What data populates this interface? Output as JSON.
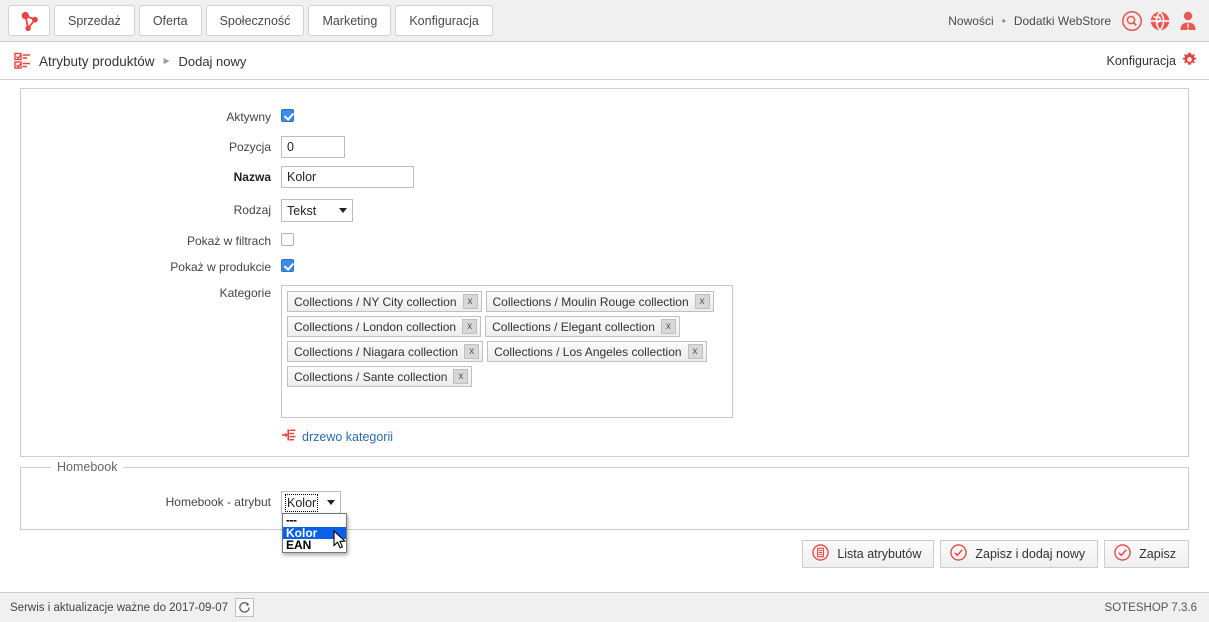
{
  "topbar": {
    "logo_icon": "soteshop-logo-icon",
    "nav": [
      {
        "label": "Sprzedaż"
      },
      {
        "label": "Oferta"
      },
      {
        "label": "Społeczność"
      },
      {
        "label": "Marketing"
      },
      {
        "label": "Konfiguracja"
      }
    ],
    "links": [
      {
        "label": "Nowości"
      },
      {
        "label": "Dodatki WebStore"
      }
    ],
    "separator": "•",
    "icons": [
      {
        "name": "search-icon"
      },
      {
        "name": "globe-icon"
      },
      {
        "name": "user-icon"
      }
    ]
  },
  "breadcrumb": {
    "icon": "product-attributes-icon",
    "title": "Atrybuty produktów",
    "arrow": "►",
    "current": "Dodaj nowy",
    "config_label": "Konfiguracja",
    "config_icon": "gear-icon"
  },
  "form": {
    "aktywny": {
      "label": "Aktywny",
      "checked": true
    },
    "pozycja": {
      "label": "Pozycja",
      "value": "0"
    },
    "nazwa": {
      "label": "Nazwa",
      "value": "Kolor"
    },
    "rodzaj": {
      "label": "Rodzaj",
      "value": "Tekst",
      "options": [
        "Tekst"
      ]
    },
    "pokaz_w_filtrach": {
      "label": "Pokaż w filtrach",
      "checked": false
    },
    "pokaz_w_produkcie": {
      "label": "Pokaż w produkcie",
      "checked": true
    },
    "kategorie": {
      "label": "Kategorie",
      "chips": [
        "Collections / NY City collection",
        "Collections / Moulin Rouge collection",
        "Collections / London collection",
        "Collections / Elegant collection",
        "Collections / Niagara collection",
        "Collections / Los Angeles collection",
        "Collections / Sante collection"
      ],
      "chip_remove_label": "x"
    },
    "tree_link": {
      "label": "drzewo kategorii",
      "icon": "category-tree-icon"
    }
  },
  "homebook": {
    "legend": "Homebook",
    "field_label": "Homebook - atrybut",
    "selected": "Kolor",
    "open": true,
    "options": [
      {
        "label": "---",
        "highlighted": false
      },
      {
        "label": "Kolor",
        "highlighted": true
      },
      {
        "label": "EAN",
        "highlighted": false
      }
    ]
  },
  "actions": [
    {
      "label": "Lista atrybutów",
      "icon": "list-document-icon"
    },
    {
      "label": "Zapisz i dodaj nowy",
      "icon": "check-circle-icon"
    },
    {
      "label": "Zapisz",
      "icon": "check-circle-icon"
    }
  ],
  "footer": {
    "service_text": "Serwis i aktualizacje ważne do 2017-09-07",
    "refresh_icon": "refresh-icon",
    "version": "SOTESHOP 7.3.6"
  },
  "colors": {
    "accent_red": "#e8443f",
    "link_blue": "#2b6cb0",
    "highlight_blue": "#0a60e8",
    "checkbox_blue": "#3b8beb",
    "chrome_gray": "#f0f0f0"
  }
}
